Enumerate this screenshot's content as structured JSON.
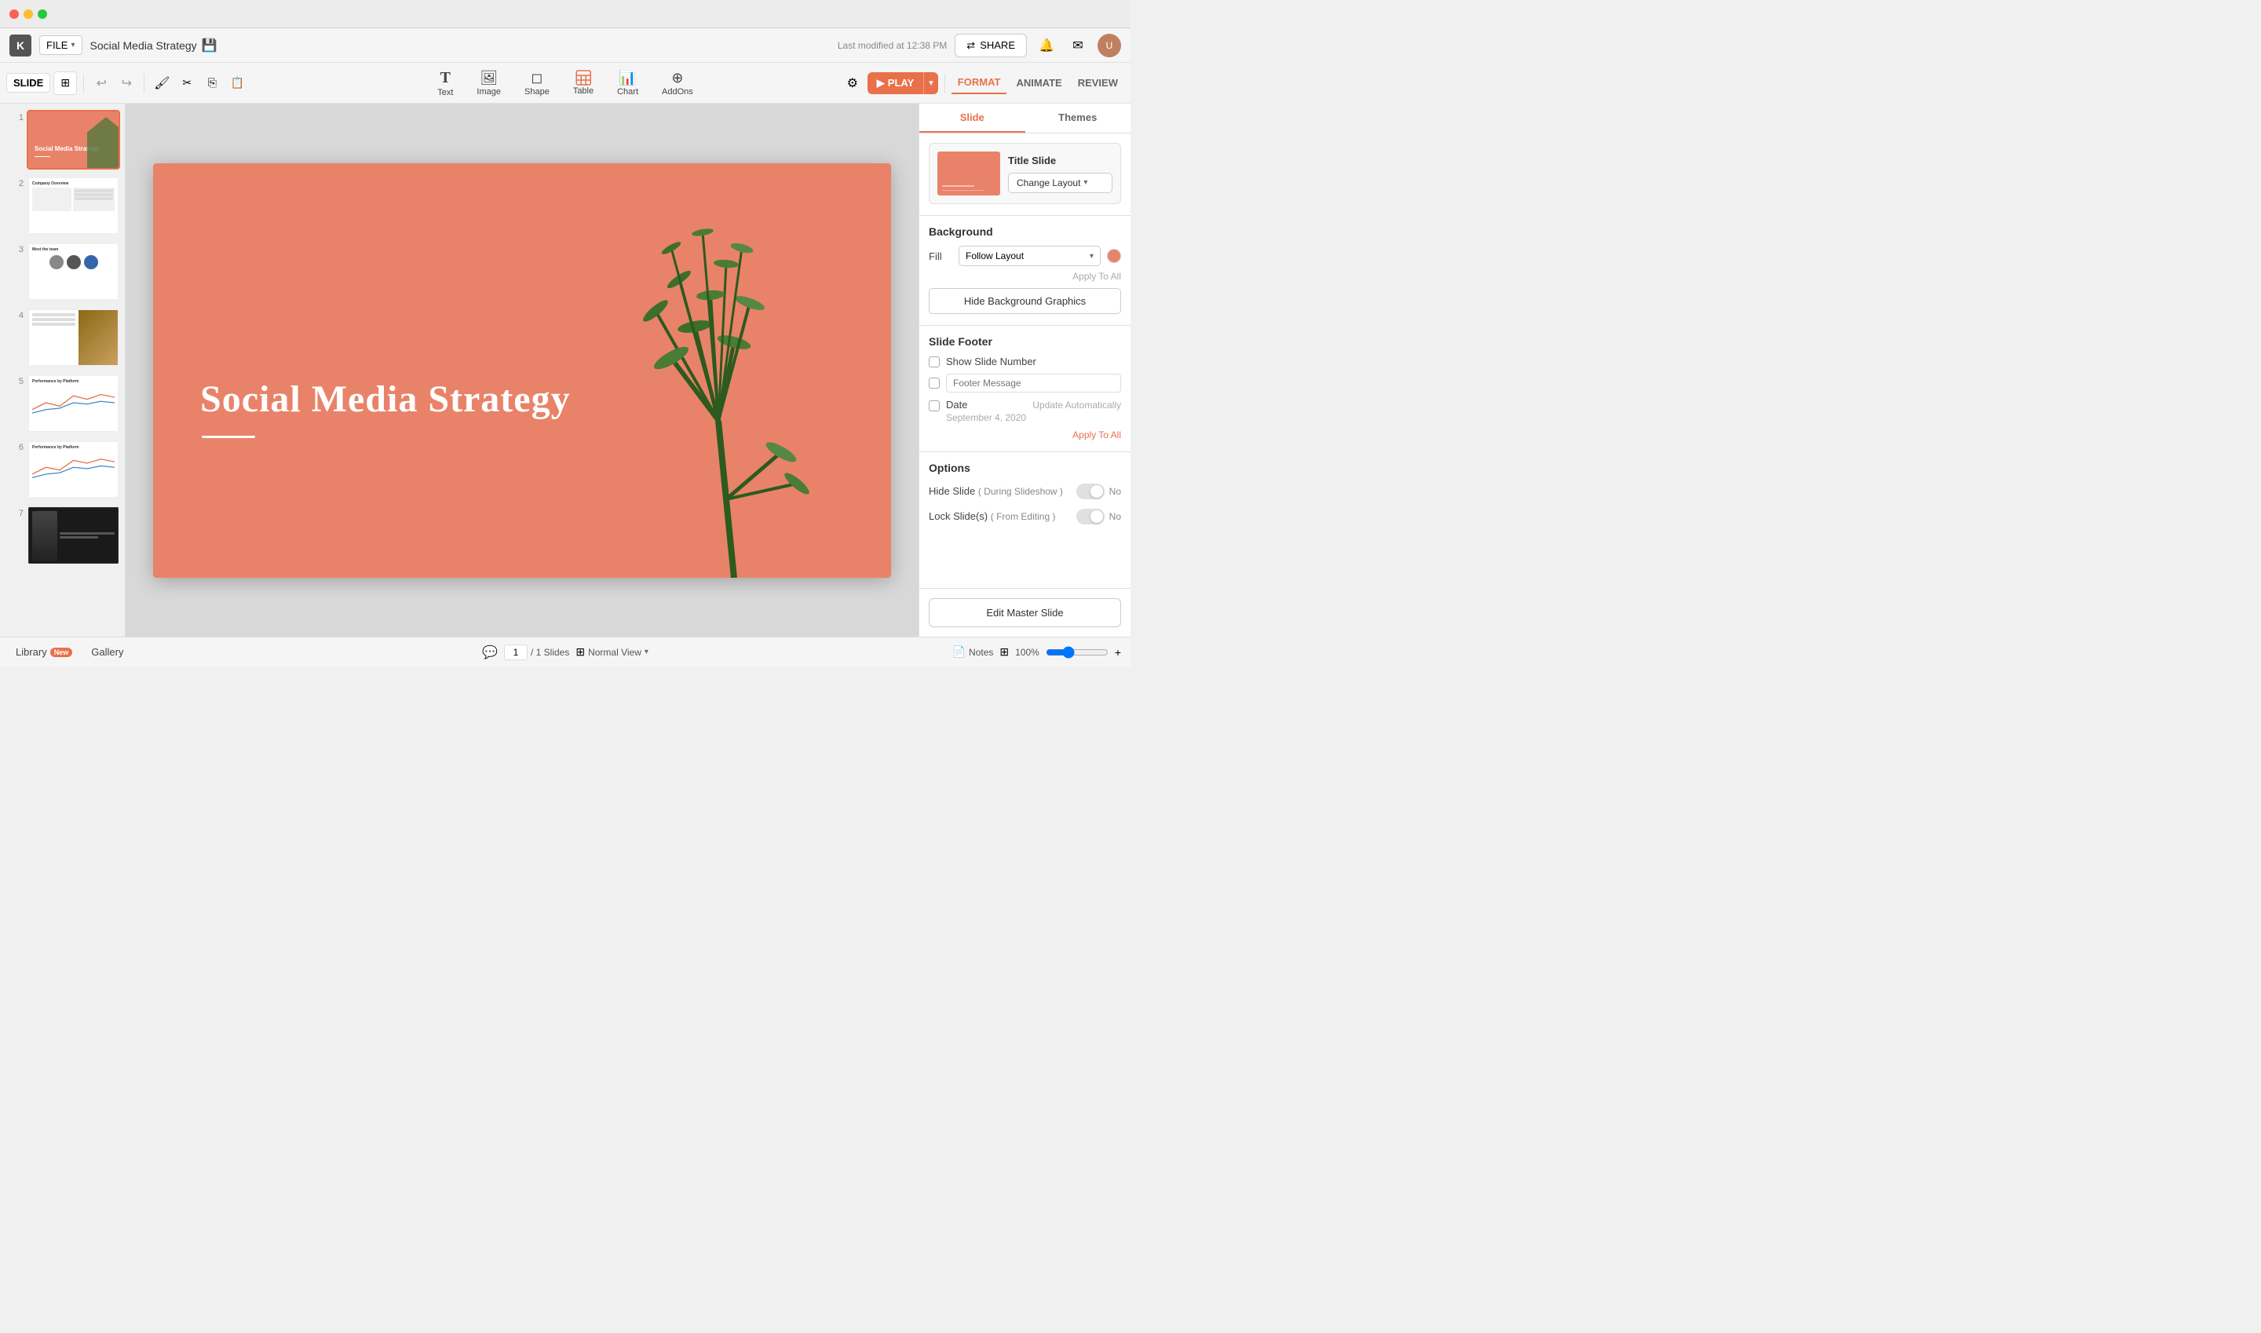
{
  "titlebar": {
    "traffic_lights": [
      "red",
      "yellow",
      "green"
    ],
    "app_icon": "▦"
  },
  "topbar": {
    "file_label": "FILE",
    "doc_title": "Social Media Strategy",
    "last_modified": "Last modified at 12:38 PM",
    "share_label": "SHARE"
  },
  "toolbar": {
    "slide_label": "SLIDE",
    "undo_icon": "↩",
    "redo_icon": "↪"
  },
  "insert_tools": [
    {
      "id": "text",
      "icon": "T",
      "label": "Text"
    },
    {
      "id": "image",
      "icon": "🖼",
      "label": "Image"
    },
    {
      "id": "shape",
      "icon": "◻",
      "label": "Shape"
    },
    {
      "id": "table",
      "icon": "⊞",
      "label": "Table"
    },
    {
      "id": "chart",
      "icon": "📊",
      "label": "Chart"
    },
    {
      "id": "addons",
      "icon": "⊕",
      "label": "AddOns"
    }
  ],
  "right_tabs": [
    "FORMAT",
    "ANIMATE",
    "REVIEW"
  ],
  "format_tabs": [
    "Slide",
    "Themes"
  ],
  "panel": {
    "layout_title": "Title Slide",
    "change_layout_label": "Change Layout",
    "background_label": "Background",
    "fill_label": "Fill",
    "follow_layout_label": "Follow Layout",
    "apply_to_all_label": "Apply To All",
    "hide_bg_label": "Hide Background Graphics",
    "footer_label": "Slide Footer",
    "show_slide_number_label": "Show Slide Number",
    "footer_message_label": "Footer Message",
    "date_label": "Date",
    "update_auto_label": "Update Automatically",
    "date_value": "September 4, 2020",
    "apply_to_all_orange": "Apply To All",
    "options_label": "Options",
    "hide_slide_label": "Hide Slide",
    "hide_slide_sub": "( During Slideshow )",
    "lock_slide_label": "Lock Slide(s)",
    "lock_slide_sub": "( From Editing )",
    "toggle_no": "No",
    "edit_master_label": "Edit Master Slide"
  },
  "slides": [
    {
      "num": 1,
      "active": true,
      "bg": "#e8836a"
    },
    {
      "num": 2,
      "active": false,
      "bg": "#ffffff"
    },
    {
      "num": 3,
      "active": false,
      "bg": "#ffffff"
    },
    {
      "num": 4,
      "active": false,
      "bg": "#ffffff"
    },
    {
      "num": 5,
      "active": false,
      "bg": "#ffffff"
    },
    {
      "num": 6,
      "active": false,
      "bg": "#ffffff"
    },
    {
      "num": 7,
      "active": false,
      "bg": "#222222"
    }
  ],
  "slide": {
    "title": "Social Media Strategy",
    "bg_color": "#e8836a"
  },
  "bottombar": {
    "chat_icon": "💬",
    "slide_num": "1",
    "total_slides": "/ 1 Slides",
    "view_icon": "⊞",
    "view_label": "Normal View",
    "notes_icon": "📄",
    "notes_label": "Notes",
    "zoom_label": "100%",
    "library_label": "Library",
    "library_badge": "New",
    "gallery_label": "Gallery"
  }
}
